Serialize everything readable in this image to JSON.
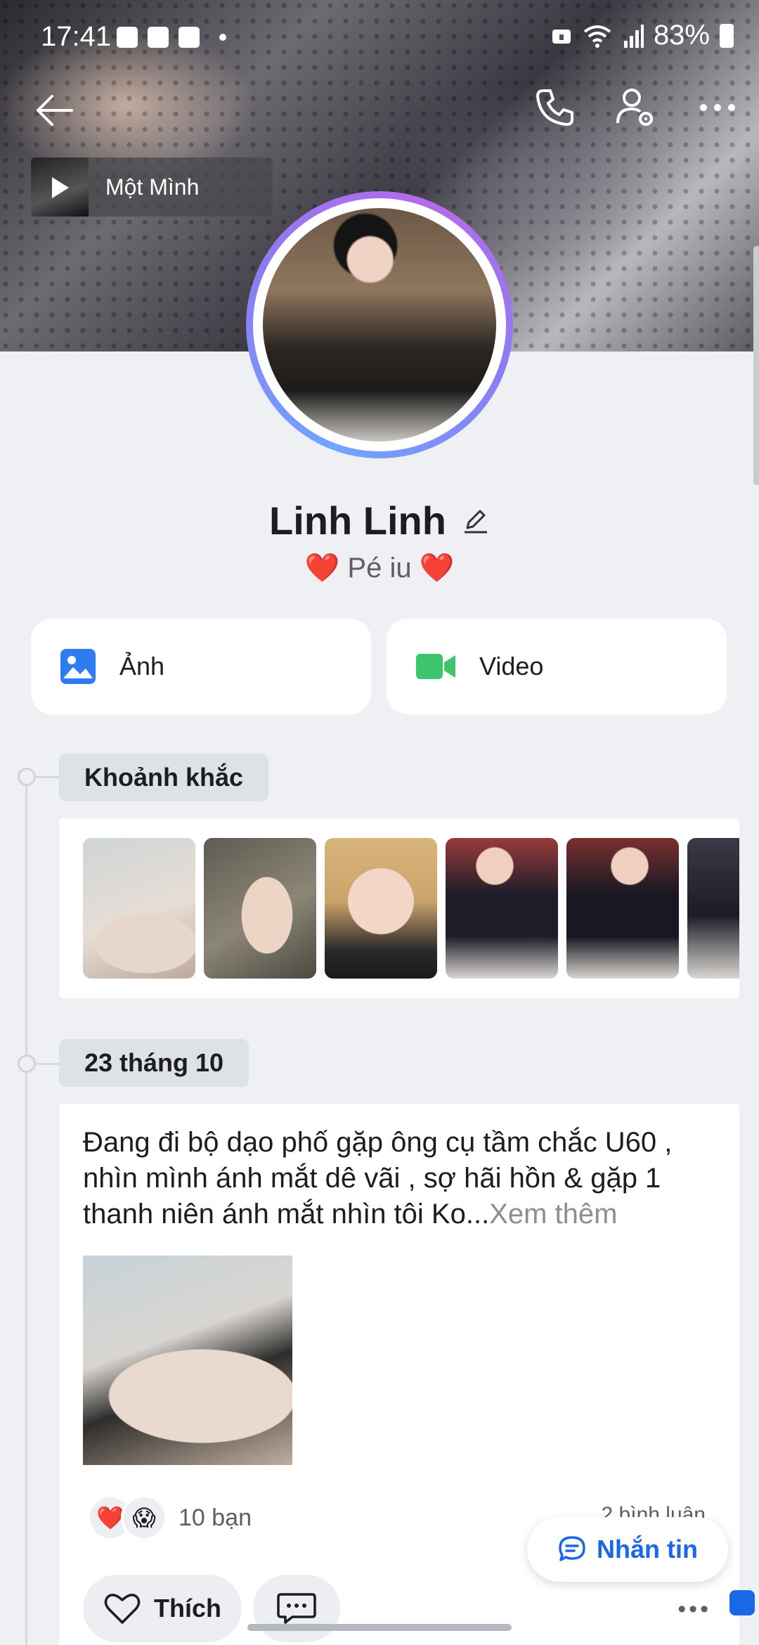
{
  "status_bar": {
    "time": "17:41",
    "battery": "83%"
  },
  "music": {
    "title": "Một Mình"
  },
  "profile": {
    "name": "Linh Linh",
    "bio": "❤️ Pé iu ❤️"
  },
  "actions": {
    "photos_label": "Ảnh",
    "video_label": "Video"
  },
  "timeline": {
    "moments_label": "Khoảnh khắc",
    "date_label": "23 tháng 10"
  },
  "post": {
    "text": "Đang đi bộ dạo phố gặp ông cụ tầm chắc U60 , nhìn mình ánh mắt dê vãi , sợ hãi hồn & gặp 1 thanh niên ánh mắt nhìn tôi Ko...",
    "see_more": "Xem thêm",
    "reaction_count": "10 bạn",
    "comments": "2 bình luận",
    "like_label": "Thích",
    "reaction_icons": [
      "❤️",
      "😱"
    ]
  },
  "fab": {
    "message_label": "Nhắn tin"
  },
  "colors": {
    "accent": "#1a67e8",
    "video_green": "#3ec46d",
    "background": "#eef0f4"
  }
}
